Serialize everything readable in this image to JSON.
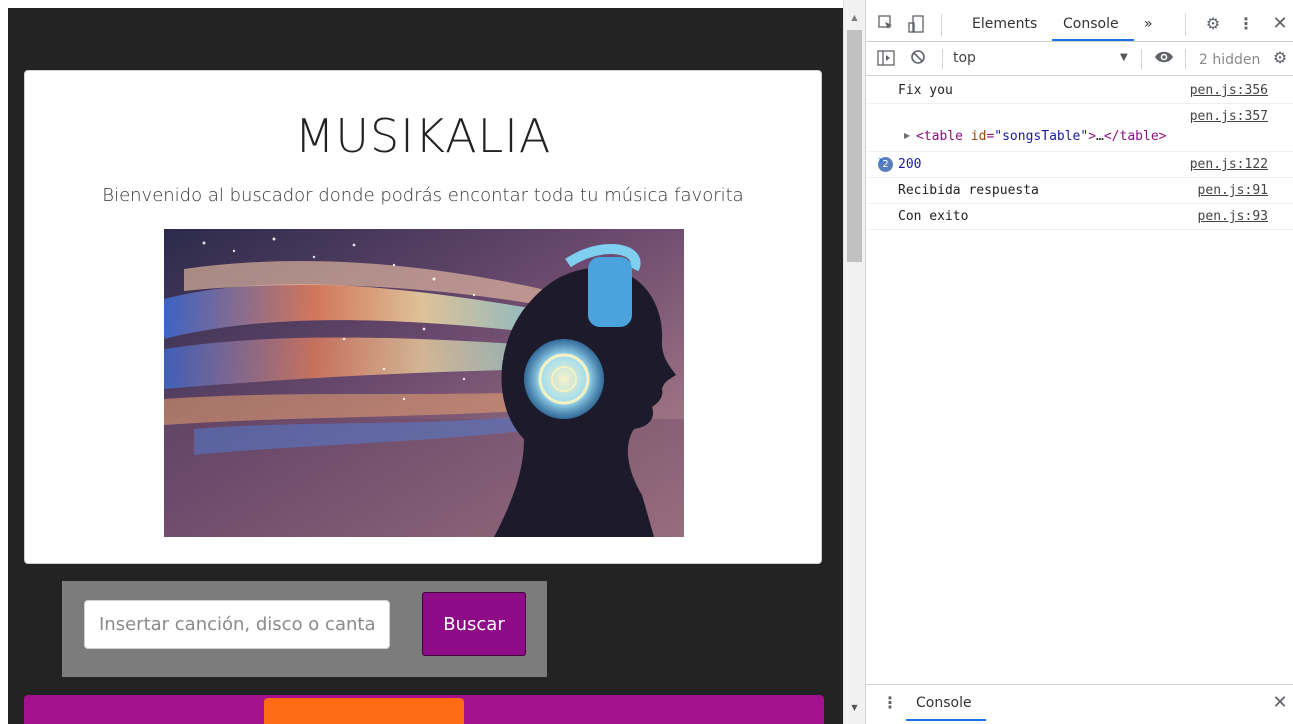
{
  "page": {
    "title": "MUSIKALIA",
    "subtitle": "Bienvenido al buscador donde podrás encontar toda tu música favorita",
    "search": {
      "placeholder": "Insertar canción, disco o cantante",
      "value": "",
      "button_label": "Buscar"
    }
  },
  "devtools": {
    "tabs": {
      "more": "»",
      "elements": "Elements",
      "console": "Console"
    },
    "context": "top",
    "hidden_count": "2 hidden",
    "logs": [
      {
        "message": "Fix you",
        "source": "pen.js:356"
      },
      {
        "source": "pen.js:357",
        "tag_open": "<table",
        "attr_name": " id",
        "attr_eq": "=",
        "attr_value": "\"songsTable\"",
        "tag_mid": ">",
        "ellipsis": "…",
        "tag_close": "</table>"
      },
      {
        "repeat": "2",
        "message": "200",
        "source": "pen.js:122"
      },
      {
        "message": "Recibida respuesta",
        "source": "pen.js:91"
      },
      {
        "message": "Con exito",
        "source": "pen.js:93"
      }
    ],
    "drawer_title": "Console"
  },
  "colors": {
    "search_button": "#8e0a86",
    "accent_blue": "#1a73e8",
    "bottom_strip": "#a3118f",
    "bottom_tab": "#ff6a12"
  }
}
